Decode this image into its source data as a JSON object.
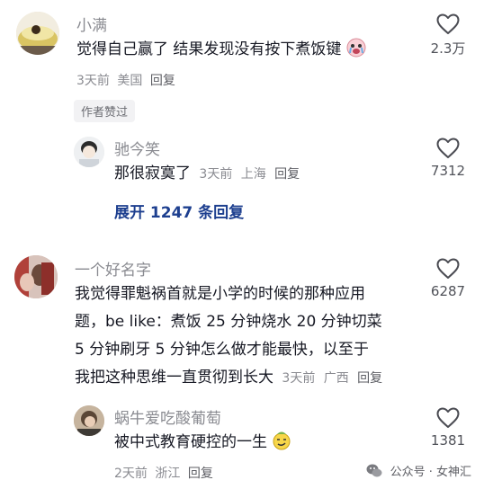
{
  "comments": [
    {
      "user": "小满",
      "text": "觉得自己赢了 结果发现没有按下煮饭键",
      "time": "3天前",
      "location": "美国",
      "reply": "回复",
      "likes": "2.3万",
      "badge": "作者赞过",
      "replies": [
        {
          "user": "驰今笑",
          "text": "那很寂寞了",
          "time": "3天前",
          "location": "上海",
          "reply": "回复",
          "likes": "7312"
        }
      ],
      "expand": "展开 1247 条回复"
    },
    {
      "user": "一个好名字",
      "text_lines": [
        "我觉得罪魁祸首就是小学的时候的那种应用",
        "题，be like：煮饭 25 分钟烧水 20 分钟切菜",
        "5 分钟刷牙 5 分钟怎么做才能最快，以至于",
        "我把这种思维一直贯彻到长大"
      ],
      "time": "3天前",
      "location": "广西",
      "reply": "回复",
      "likes": "6287",
      "replies": [
        {
          "user": "蜗牛爱吃酸葡萄",
          "text": "被中式教育硬控的一生",
          "time": "2天前",
          "location": "浙江",
          "reply": "回复",
          "likes": "1381"
        }
      ]
    }
  ],
  "watermark": "公众号 · 女神汇",
  "icons": {
    "like": "heart-outline-icon",
    "emoji1": "crying-face-emoji-icon",
    "emoji2": "smirk-face-emoji-icon",
    "wechat": "wechat-logo-icon"
  }
}
